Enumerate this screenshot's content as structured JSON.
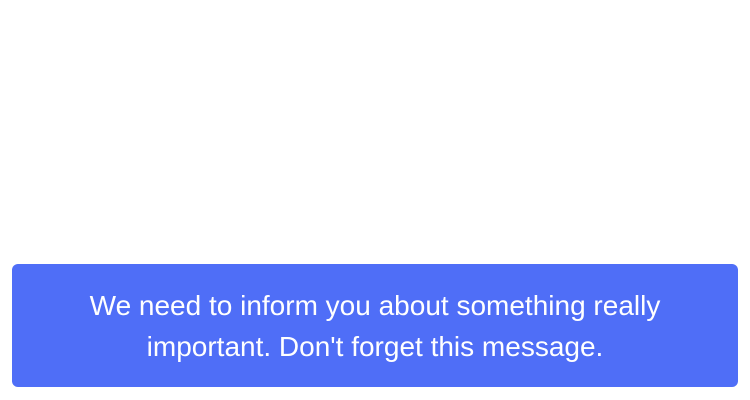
{
  "toast": {
    "message": "We need to inform you about something really important. Don't forget this message.",
    "background_color": "#4f6ef7",
    "text_color": "#ffffff"
  },
  "page": {
    "background_color": "#ffffff"
  }
}
